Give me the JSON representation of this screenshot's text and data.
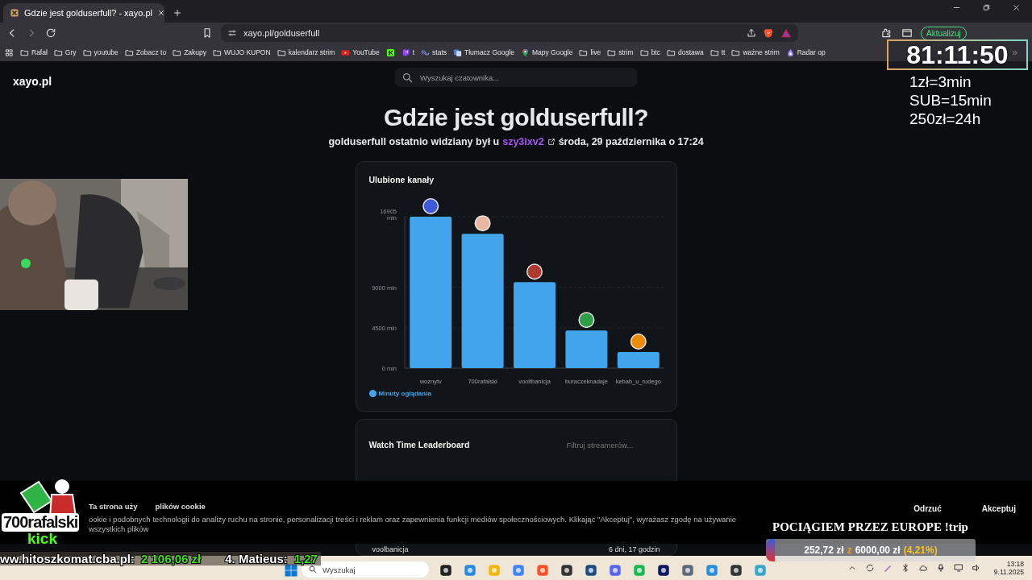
{
  "browser": {
    "tabs": [
      {
        "title": "Gdzie jest golduserfull? - xayo.pl",
        "selected": true
      }
    ],
    "address": "xayo.pl/golduserfull",
    "update_button": "Aktualizuj",
    "bookmarks": [
      {
        "label": "Rafał",
        "kind": "folder"
      },
      {
        "label": "Gry",
        "kind": "folder"
      },
      {
        "label": "youtube",
        "kind": "folder"
      },
      {
        "label": "Zobacz to",
        "kind": "folder"
      },
      {
        "label": "Zakupy",
        "kind": "folder"
      },
      {
        "label": "WUJO KUPON",
        "kind": "folder"
      },
      {
        "label": "kalendarz strim",
        "kind": "folder"
      },
      {
        "label": "YouTube",
        "kind": "video"
      },
      {
        "kind": "green"
      },
      {
        "label": "t",
        "kind": "chat"
      },
      {
        "label": "stats",
        "kind": "wave"
      },
      {
        "label": "Tłumacz Google",
        "kind": "translate"
      },
      {
        "label": "Mapy Google",
        "kind": "pin"
      },
      {
        "label": "live",
        "kind": "folder"
      },
      {
        "label": "strim",
        "kind": "folder"
      },
      {
        "label": "btc",
        "kind": "folder"
      },
      {
        "label": "dostawa",
        "kind": "folder"
      },
      {
        "label": "tt",
        "kind": "folder"
      },
      {
        "label": "ważne strim",
        "kind": "folder"
      },
      {
        "label": "Radar op",
        "kind": "drop"
      }
    ],
    "more_bookmarks": "»"
  },
  "site": {
    "logo": "xayo.pl",
    "search": {
      "placeholder": "Wyszukaj czatownika..."
    },
    "title": "Gdzie jest golduserfull?",
    "last_seen": {
      "text": "golduserfull ostatnio widziany był u",
      "channel": "szy3ixv2",
      "when": "środa, 29 października o 17:24"
    },
    "favorites": {
      "title": "Ulubione kanały",
      "chart_data": {
        "type": "bar",
        "categories": [
          "woznytv",
          "700rafalski",
          "vooltbanicja",
          "buraczeknadaje",
          "kebab_u_rudego"
        ],
        "series": [
          {
            "name": "Minuty oglądania",
            "color": "#42a5ec",
            "values": [
              16905,
              15000,
              9600,
              4200,
              1800
            ]
          }
        ],
        "ylim": [
          0,
          16905
        ],
        "yticks": [
          {
            "value": 0,
            "label": "0 min"
          },
          {
            "value": 4500,
            "label": "4500 min"
          },
          {
            "value": 9000,
            "label": "9000 min"
          },
          {
            "value": 16905,
            "label": "16905 min"
          }
        ]
      }
    },
    "leaderboard": {
      "title": "Watch Time Leaderboard",
      "filter": {
        "placeholder": "Filtruj streamerów..."
      },
      "rows": [
        {
          "streamer": "voolbanicja",
          "time": "6 dni, 17 godzin"
        }
      ]
    },
    "cookie_banner": {
      "title_parts": [
        "Ta strona uży",
        "plików cookie"
      ],
      "text": "ookie i podobnych technologii do analizy ruchu na stronie, personalizacji treści i reklam oraz zapewnienia funkcji mediów społecznościowych. Klikając \"Akceptuj\", wyrażasz zgodę na używanie wszystkich plików",
      "buttons": [
        "Odrzuć",
        "Akceptuj"
      ]
    }
  },
  "overlays": {
    "timer": "81:11:50",
    "rates": [
      "1zł=3min",
      "SUB=15min",
      "250zł=24h"
    ],
    "logo": {
      "name": "700rafalski",
      "platform": "kick"
    },
    "ticker": [
      {
        "label": "ww.hitoszkomat.cba.pl:",
        "amount": "2 106,06 zł"
      },
      {
        "label": "4. Matieus:",
        "amount": "1,27"
      }
    ],
    "donation": {
      "title": "POCIĄGIEM PRZEZ EUROPE !trip",
      "raised": "252,72 zł",
      "separator": "z",
      "goal": "6000,00 zł",
      "percent": "(4,21%)",
      "level": 0.0421
    }
  },
  "taskbar": {
    "search": {
      "placeholder": "Wyszukaj"
    },
    "time": "13:18",
    "date": "9.11.2025"
  }
}
